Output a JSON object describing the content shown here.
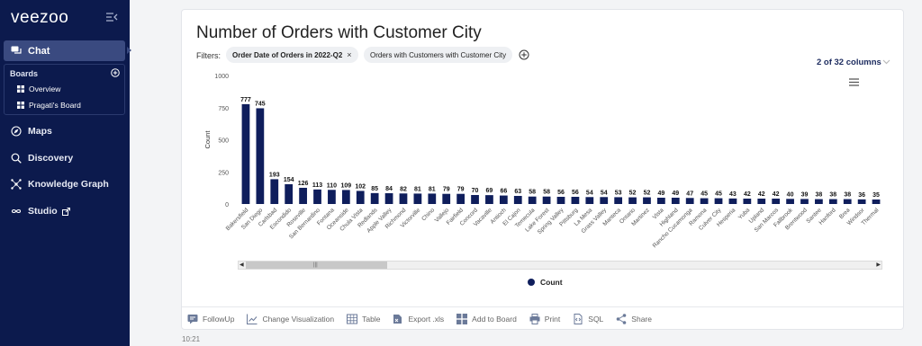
{
  "sidebar": {
    "logo": "veezoo",
    "chat": "Chat",
    "boards_title": "Boards",
    "boards": [
      "Overview",
      "Pragati's Board"
    ],
    "nav": [
      {
        "label": "Maps",
        "icon": "compass-icon"
      },
      {
        "label": "Discovery",
        "icon": "search-icon"
      },
      {
        "label": "Knowledge Graph",
        "icon": "graph-icon"
      },
      {
        "label": "Studio",
        "icon": "infinity-icon"
      }
    ]
  },
  "main": {
    "title": "Number of Orders with Customer City",
    "filters_label": "Filters:",
    "filter_1": "Order Date of Orders in 2022-Q2",
    "filter_1_remove": "×",
    "filter_2": "Orders with Customers with Customer City",
    "columns_indicator": "2 of 32 columns",
    "timestamp": "10:21"
  },
  "toolbar": [
    "FollowUp",
    "Change Visualization",
    "Table",
    "Export .xls",
    "Add to Board",
    "Print",
    "SQL",
    "Share"
  ],
  "colors": {
    "sidebar": "#0c1a4d",
    "bar": "#0f1e5c",
    "accent": "#3a4a80"
  },
  "chart_data": {
    "type": "bar",
    "ylabel": "Count",
    "ylim": [
      0,
      1000
    ],
    "yticks": [
      "0",
      "250",
      "500",
      "750",
      "1000"
    ],
    "legend": "Count",
    "categories": [
      "Bakersfield",
      "San Diego",
      "Carlsbad",
      "Escondido",
      "Roseville",
      "San Bernardino",
      "Fontana",
      "Oceanside",
      "Chula Vista",
      "Redlands",
      "Apple Valley",
      "Richmond",
      "Victorville",
      "Chino",
      "Vallejo",
      "Fairfield",
      "Concord",
      "Vacaville",
      "Antioch",
      "El Cajon",
      "Temecula",
      "Lake Forest",
      "Spring Valley",
      "Pittsburg",
      "La Mesa",
      "Grass Valley",
      "Manteca",
      "Ontario",
      "Martinez",
      "Vista",
      "Highland",
      "Rancho Cucamonga",
      "Ramona",
      "Culver City",
      "Hesperia",
      "Yuba",
      "Upland",
      "San Marcos",
      "Fallbrook",
      "Brentwood",
      "Santee",
      "Hanford",
      "Brea",
      "Windsor",
      "Thermal"
    ],
    "values": [
      777,
      745,
      193,
      154,
      126,
      113,
      110,
      109,
      102,
      85,
      84,
      82,
      81,
      81,
      79,
      79,
      70,
      69,
      66,
      63,
      58,
      58,
      56,
      56,
      54,
      54,
      53,
      52,
      52,
      49,
      49,
      47,
      45,
      45,
      43,
      42,
      42,
      42,
      40,
      39,
      38,
      38,
      38,
      36,
      35
    ]
  }
}
